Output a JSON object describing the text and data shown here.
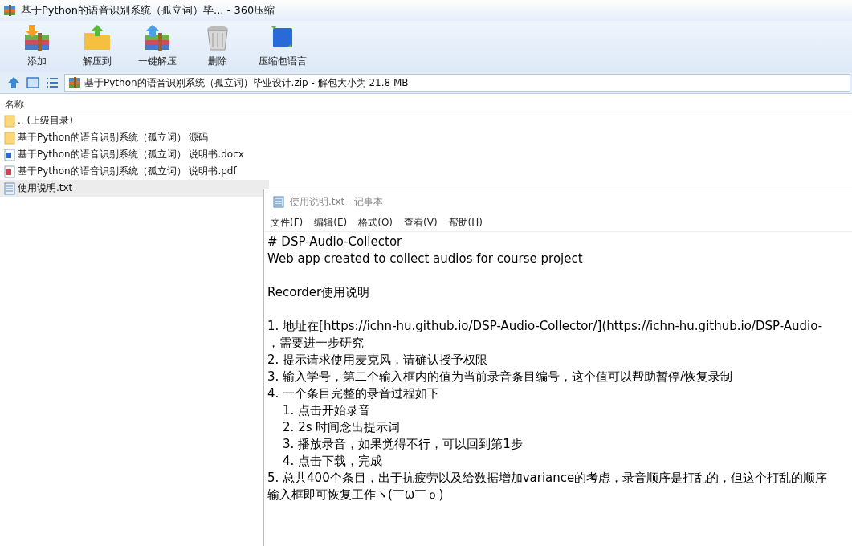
{
  "window": {
    "title": "基于Python的语音识别系统（孤立词）毕... - 360压缩"
  },
  "toolbar": [
    {
      "label": "添加",
      "kind": "add"
    },
    {
      "label": "解压到",
      "kind": "extract-to"
    },
    {
      "label": "一键解压",
      "kind": "extract"
    },
    {
      "label": "删除",
      "kind": "delete"
    },
    {
      "label": "压缩包语言",
      "kind": "language"
    }
  ],
  "address_bar": {
    "value": "基于Python的语音识别系统（孤立词）毕业设计.zip - 解包大小为 21.8 MB"
  },
  "file_list": {
    "columns": [
      "名称"
    ],
    "rows": [
      {
        "name": ".. (上级目录)",
        "kind": "folder",
        "selected": false
      },
      {
        "name": "基于Python的语音识别系统（孤立词） 源码",
        "kind": "folder",
        "selected": false
      },
      {
        "name": "基于Python的语音识别系统（孤立词） 说明书.docx",
        "kind": "word",
        "selected": false
      },
      {
        "name": "基于Python的语音识别系统（孤立词） 说明书.pdf",
        "kind": "pdf",
        "selected": false
      },
      {
        "name": "使用说明.txt",
        "kind": "text",
        "selected": true
      }
    ]
  },
  "notepad": {
    "title": "使用说明.txt - 记事本",
    "menu": [
      "文件(F)",
      "编辑(E)",
      "格式(O)",
      "查看(V)",
      "帮助(H)"
    ],
    "blocks": [
      [
        "# DSP-Audio-Collector",
        "Web app created to collect audios for course project"
      ],
      [
        "Recorder使用说明"
      ],
      [
        "1. 地址在[https://ichn-hu.github.io/DSP-Audio-Collector/](https://ichn-hu.github.io/DSP-Audio-",
        "，需要进一步研究",
        "2. 提示请求使用麦克风，请确认授予权限",
        "3. 输入学号，第二个输入框内的值为当前录音条目编号，这个值可以帮助暂停/恢复录制",
        "4. 一个条目完整的录音过程如下",
        "    1. 点击开始录音",
        "    2. 2s 时间念出提示词",
        "    3. 播放录音，如果觉得不行，可以回到第1步",
        "    4. 点击下载，完成",
        "5. 总共400个条目，出于抗疲劳以及给数据增加variance的考虑，录音顺序是打乱的，但这个打乱的顺序",
        "输入框即可恢复工作ヽ(￣ω￣ｏ)"
      ]
    ]
  }
}
